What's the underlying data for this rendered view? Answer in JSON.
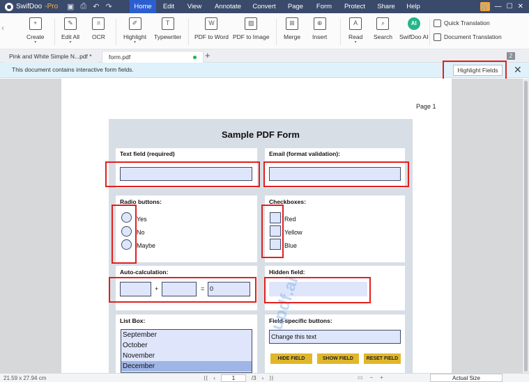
{
  "app": {
    "name": "SwifDoo",
    "edition": "-Pro"
  },
  "menu": [
    {
      "label": "Home",
      "active": true
    },
    {
      "label": "Edit"
    },
    {
      "label": "View"
    },
    {
      "label": "Annotate"
    },
    {
      "label": "Convert"
    },
    {
      "label": "Page"
    },
    {
      "label": "Form"
    },
    {
      "label": "Protect"
    },
    {
      "label": "Share"
    },
    {
      "label": "Help"
    }
  ],
  "ribbon": {
    "create": "Create",
    "edit_all": "Edit All",
    "ocr": "OCR",
    "highlight": "Highlight",
    "typewriter": "Typewriter",
    "pdf_to_word": "PDF to Word",
    "pdf_to_image": "PDF to Image",
    "merge": "Merge",
    "insert": "Insert",
    "read": "Read",
    "search": "Search",
    "swifdoo_ai": "SwifDoo AI",
    "ai_badge": "AI",
    "quick_translation": "Quick Translation",
    "document_translation": "Document Translation"
  },
  "tabs": [
    {
      "label": "Pink and White Simple N...pdf *"
    },
    {
      "label": "form.pdf"
    }
  ],
  "tab_count": "2",
  "infobar": {
    "message": "This document contains interactive form fields.",
    "button": "Highlight Fields"
  },
  "document": {
    "page_label": "Page 1",
    "title": "Sample PDF Form",
    "text_field_label": "Text field (required)",
    "email_label": "Email (format validation):",
    "radio_label": "Radio buttons:",
    "radio_options": [
      "Yes",
      "No",
      "Maybe"
    ],
    "checkbox_label": "Checkboxes:",
    "checkbox_options": [
      "Red",
      "Yellow",
      "Blue"
    ],
    "autocalc_label": "Auto-calculation:",
    "plus": "+",
    "equals": "=",
    "autocalc_result": "0",
    "hidden_label": "Hidden field:",
    "listbox_label": "List Box:",
    "listbox_items": [
      "September",
      "October",
      "November",
      "December"
    ],
    "listbox_selected": "December",
    "buttons_label": "Field-specific buttons:",
    "change_text": "Change this text",
    "hide_field": "HIDE FIELD",
    "show_field": "SHOW FIELD",
    "reset_field": "RESET FIELD",
    "watermark": "updf.ai"
  },
  "status": {
    "dimensions": "21.59 x 27.94 cm",
    "current_page": "1",
    "total_pages": "/3",
    "zoom": "Actual Size"
  },
  "colors": {
    "menubar": "#3a4a6b",
    "active_menu": "#2b5fd0",
    "infobar": "#dff2fb",
    "field_fill": "#dfe6fb",
    "highlight_outline": "#e0201e",
    "action_button": "#e0b72a"
  }
}
